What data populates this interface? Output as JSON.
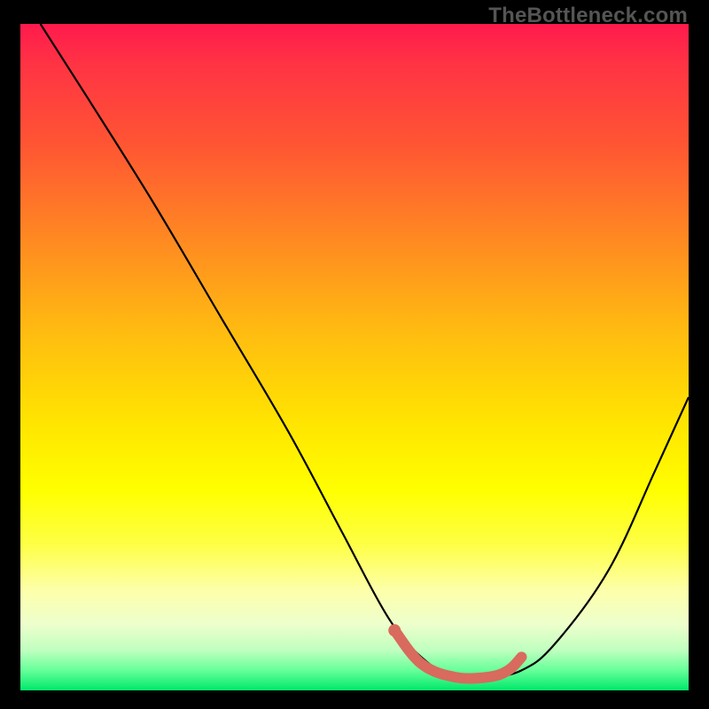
{
  "watermark": "TheBottleneck.com",
  "chart_data": {
    "type": "line",
    "title": "",
    "xlabel": "",
    "ylabel": "",
    "xlim": [
      0,
      100
    ],
    "ylim": [
      0,
      100
    ],
    "series": [
      {
        "name": "bottleneck-curve",
        "x": [
          3,
          10,
          20,
          30,
          40,
          48,
          55,
          60,
          65,
          70,
          75,
          80,
          88,
          95,
          100
        ],
        "y": [
          100,
          89,
          73,
          56,
          39,
          24,
          11,
          5,
          2,
          2,
          3,
          7,
          18,
          33,
          44
        ]
      }
    ],
    "highlight": {
      "name": "optimal-zone",
      "x": [
        56,
        60,
        65,
        70,
        73,
        75
      ],
      "y": [
        9,
        4,
        2,
        2,
        3,
        5
      ]
    },
    "colors": {
      "curve": "#000000",
      "highlight": "#d86a5e",
      "gradient_top": "#ff1a4d",
      "gradient_bottom": "#00e86b"
    }
  }
}
